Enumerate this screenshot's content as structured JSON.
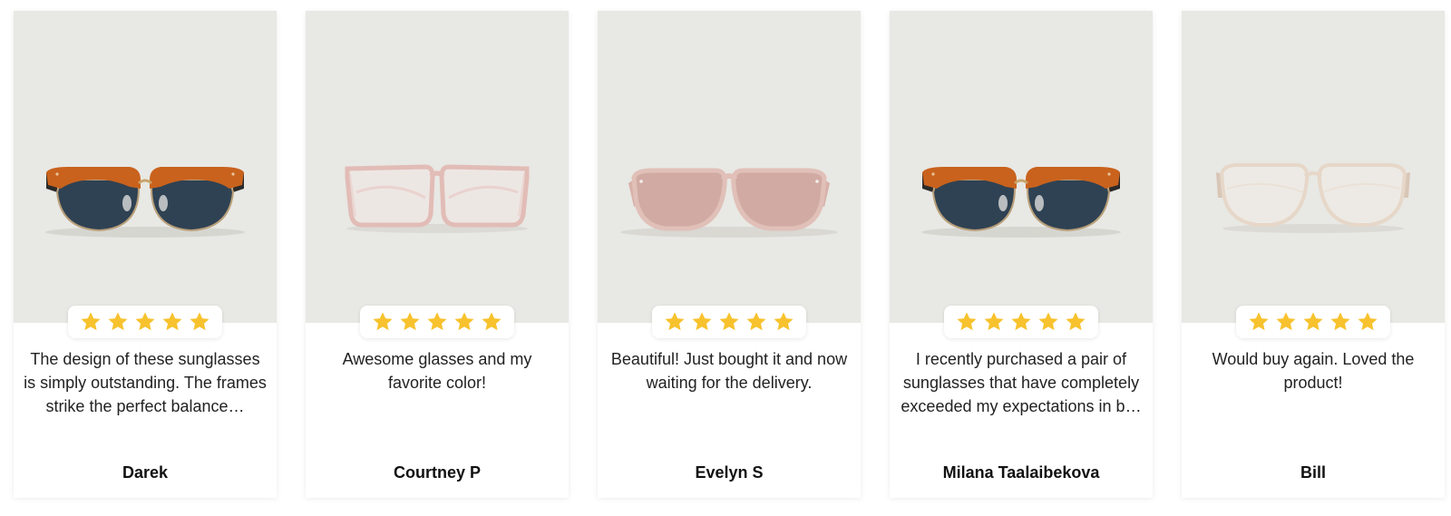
{
  "colors": {
    "photo_bg": "#e8e8e4",
    "star": "#f7c22d",
    "card_bg": "#ffffff",
    "text": "#222222"
  },
  "reviews": [
    {
      "product_icon": "sunglasses-orange-browline-icon",
      "rating": 5,
      "text": "The design of these sunglasses is simply outstanding. The frames strike the perfect balance…",
      "author": "Darek"
    },
    {
      "product_icon": "eyeglasses-clear-pink-square-icon",
      "rating": 5,
      "text": "Awesome glasses and my favorite color!",
      "author": "Courtney P"
    },
    {
      "product_icon": "sunglasses-pink-aviator-icon",
      "rating": 5,
      "text": "Beautiful! Just bought it and now waiting for the delivery.",
      "author": "Evelyn S"
    },
    {
      "product_icon": "sunglasses-orange-browline-icon",
      "rating": 5,
      "text": "I recently purchased a pair of sunglasses that have completely exceeded my expectations in b…",
      "author": "Milana Taalaibekova"
    },
    {
      "product_icon": "eyeglasses-clear-beige-round-icon",
      "rating": 5,
      "text": "Would buy again. Loved the product!",
      "author": "Bill"
    }
  ]
}
